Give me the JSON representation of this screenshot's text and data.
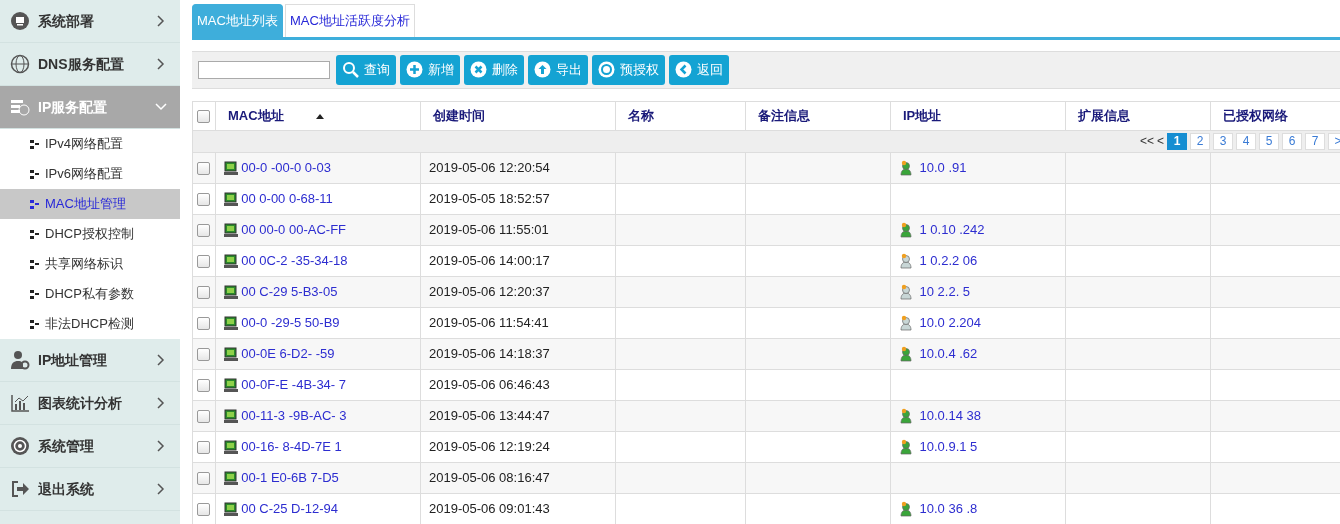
{
  "sidebar": {
    "items": [
      {
        "label": "系统部署",
        "expanded": false
      },
      {
        "label": "DNS服务配置",
        "expanded": false
      },
      {
        "label": "IP服务配置",
        "expanded": true,
        "children": [
          {
            "label": "IPv4网络配置",
            "selected": false
          },
          {
            "label": "IPv6网络配置",
            "selected": false
          },
          {
            "label": "MAC地址管理",
            "selected": true
          },
          {
            "label": "DHCP授权控制",
            "selected": false
          },
          {
            "label": "共享网络标识",
            "selected": false
          },
          {
            "label": "DHCP私有参数",
            "selected": false
          },
          {
            "label": "非法DHCP检测",
            "selected": false
          }
        ]
      },
      {
        "label": "IP地址管理",
        "expanded": false
      },
      {
        "label": "图表统计分析",
        "expanded": false
      },
      {
        "label": "系统管理",
        "expanded": false
      },
      {
        "label": "退出系统",
        "expanded": false
      }
    ]
  },
  "tabs": [
    {
      "label": "MAC地址列表",
      "selected": true
    },
    {
      "label": "MAC地址活跃度分析",
      "selected": false
    }
  ],
  "toolbar": {
    "buttons": [
      {
        "label": "查询"
      },
      {
        "label": "新增"
      },
      {
        "label": "删除"
      },
      {
        "label": "导出"
      },
      {
        "label": "预授权"
      },
      {
        "label": "返回"
      }
    ]
  },
  "table": {
    "select_all_checked": false,
    "columns": [
      {
        "label": "MAC地址",
        "sorted_ascending": true
      },
      {
        "label": "创建时间"
      },
      {
        "label": "名称"
      },
      {
        "label": "备注信息"
      },
      {
        "label": "IP地址"
      },
      {
        "label": "扩展信息"
      },
      {
        "label": "已授权网络"
      }
    ],
    "pagination": {
      "first": "<<",
      "prev": "<",
      "pages": [
        {
          "label": "1",
          "selected": true
        },
        {
          "label": "2",
          "selected": false
        },
        {
          "label": "3",
          "selected": false
        },
        {
          "label": "4",
          "selected": false
        },
        {
          "label": "5",
          "selected": false
        },
        {
          "label": "6",
          "selected": false
        },
        {
          "label": "7",
          "selected": false
        }
      ],
      "next": ">"
    },
    "rows": [
      {
        "checked": false,
        "mac": "00-0 -00-0 0-03",
        "created": "2019-05-06 12:20:54",
        "ip": "10.0 .91",
        "online": true
      },
      {
        "checked": false,
        "mac": "00 0-00 0-68-11",
        "created": "2019-05-05 18:52:57"
      },
      {
        "checked": false,
        "mac": "00 00-0 00-AC-FF",
        "created": "2019-05-06 11:55:01",
        "ip": "1 0.10 .242",
        "online": true
      },
      {
        "checked": false,
        "mac": "00 0C-2 -35-34-18",
        "created": "2019-05-06 14:00:17",
        "ip": "1 0.2.2 06",
        "online": false
      },
      {
        "checked": false,
        "mac": "00 C-29 5-B3-05",
        "created": "2019-05-06 12:20:37",
        "ip": "10 2.2. 5",
        "online": false
      },
      {
        "checked": false,
        "mac": "00-0 -29-5 50-B9",
        "created": "2019-05-06 11:54:41",
        "ip": "10.0 2.204",
        "online": false
      },
      {
        "checked": false,
        "mac": "00-0E 6-D2- -59",
        "created": "2019-05-06 14:18:37",
        "ip": "10.0.4 .62",
        "online": true
      },
      {
        "checked": false,
        "mac": "00-0F-E -4B-34- 7",
        "created": "2019-05-06 06:46:43"
      },
      {
        "checked": false,
        "mac": "00-11-3 -9B-AC- 3",
        "created": "2019-05-06 13:44:47",
        "ip": "10.0.14 38",
        "online": true
      },
      {
        "checked": false,
        "mac": "00-16- 8-4D-7E 1",
        "created": "2019-05-06 12:19:24",
        "ip": "10.0.9.1 5",
        "online": true
      },
      {
        "checked": false,
        "mac": "00-1 E0-6B 7-D5",
        "created": "2019-05-06 08:16:47"
      },
      {
        "checked": false,
        "mac": "00 C-25 D-12-94",
        "created": "2019-05-06 09:01:43",
        "ip": "10.0 36 .8",
        "online": true
      }
    ]
  }
}
